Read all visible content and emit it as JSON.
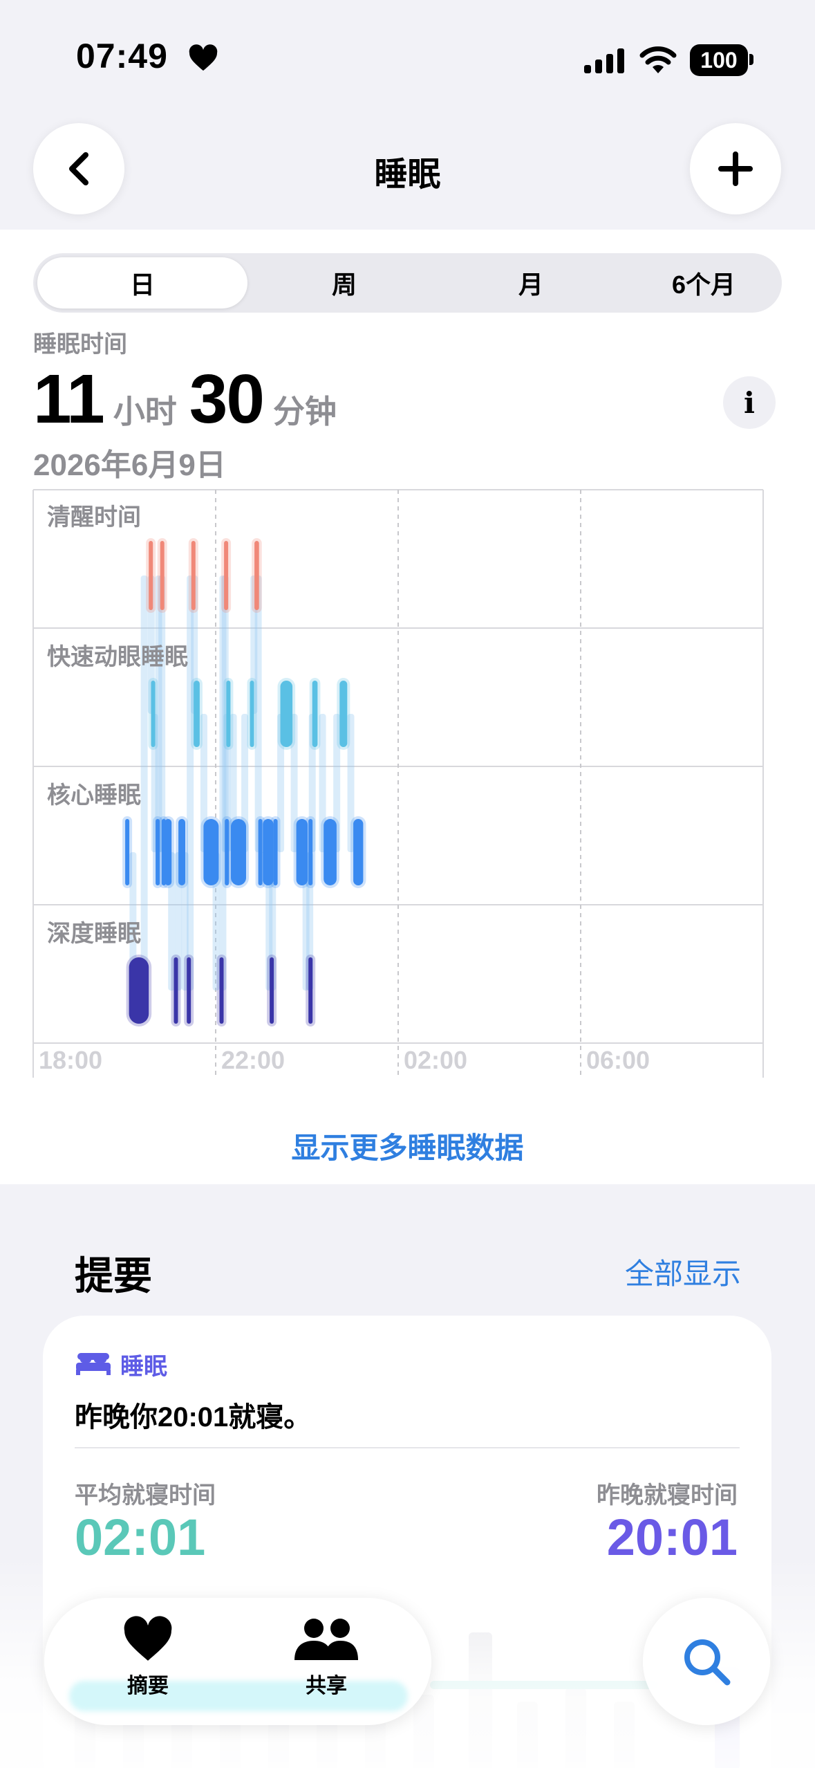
{
  "status_bar": {
    "time": "07:49",
    "battery": "100"
  },
  "nav": {
    "title": "睡眠"
  },
  "segments": [
    "日",
    "周",
    "月",
    "6个月"
  ],
  "summary": {
    "label": "睡眠时间",
    "hours": "11",
    "hours_unit": "小时",
    "minutes": "30",
    "minutes_unit": "分钟",
    "date": "2026年6月9日"
  },
  "stages": [
    "清醒时间",
    "快速动眼睡眠",
    "核心睡眠",
    "深度睡眠"
  ],
  "chart_data": {
    "type": "timeline",
    "x_ticks": [
      "18:00",
      "22:00",
      "02:00",
      "06:00"
    ],
    "stage_order": [
      "awake",
      "rem",
      "core",
      "deep"
    ],
    "colors": {
      "awake": "#f08878",
      "rem": "#5ac0e4",
      "core": "#3a8af0",
      "deep": "#3a35a8"
    },
    "segments": [
      {
        "stage": "core",
        "start": "20:01",
        "end": "20:06"
      },
      {
        "stage": "deep",
        "start": "20:06",
        "end": "20:32"
      },
      {
        "stage": "awake",
        "start": "20:32",
        "end": "20:34"
      },
      {
        "stage": "rem",
        "start": "20:35",
        "end": "20:40"
      },
      {
        "stage": "core",
        "start": "20:41",
        "end": "20:43"
      },
      {
        "stage": "awake",
        "start": "20:47",
        "end": "20:49"
      },
      {
        "stage": "core",
        "start": "20:49",
        "end": "20:52"
      },
      {
        "stage": "core",
        "start": "20:53",
        "end": "21:02"
      },
      {
        "stage": "deep",
        "start": "21:05",
        "end": "21:08"
      },
      {
        "stage": "core",
        "start": "21:11",
        "end": "21:20"
      },
      {
        "stage": "deep",
        "start": "21:22",
        "end": "21:26"
      },
      {
        "stage": "awake",
        "start": "21:28",
        "end": "21:30"
      },
      {
        "stage": "rem",
        "start": "21:31",
        "end": "21:39"
      },
      {
        "stage": "core",
        "start": "21:44",
        "end": "22:04"
      },
      {
        "stage": "deep",
        "start": "22:05",
        "end": "22:09"
      },
      {
        "stage": "awake",
        "start": "22:11",
        "end": "22:13"
      },
      {
        "stage": "core",
        "start": "22:12",
        "end": "22:14"
      },
      {
        "stage": "rem",
        "start": "22:14",
        "end": "22:19"
      },
      {
        "stage": "core",
        "start": "22:20",
        "end": "22:40"
      },
      {
        "stage": "rem",
        "start": "22:45",
        "end": "22:48"
      },
      {
        "stage": "awake",
        "start": "22:51",
        "end": "22:57"
      },
      {
        "stage": "core",
        "start": "22:56",
        "end": "23:00"
      },
      {
        "stage": "core",
        "start": "23:02",
        "end": "23:16"
      },
      {
        "stage": "deep",
        "start": "23:11",
        "end": "23:12"
      },
      {
        "stage": "core",
        "start": "23:16",
        "end": "23:20"
      },
      {
        "stage": "rem",
        "start": "23:25",
        "end": "23:41"
      },
      {
        "stage": "core",
        "start": "23:46",
        "end": "24:01"
      },
      {
        "stage": "deep",
        "start": "24:02",
        "end": "24:06"
      },
      {
        "stage": "core",
        "start": "24:02",
        "end": "24:05"
      },
      {
        "stage": "rem",
        "start": "24:07",
        "end": "24:14"
      },
      {
        "stage": "core",
        "start": "24:22",
        "end": "24:39"
      },
      {
        "stage": "rem",
        "start": "24:43",
        "end": "24:53"
      },
      {
        "stage": "core",
        "start": "25:01",
        "end": "25:14"
      }
    ]
  },
  "more_link": "显示更多睡眠数据",
  "highlights": {
    "title": "提要",
    "show_all": "全部显示",
    "card": {
      "category": "睡眠",
      "text": "昨晚你20:01就寝。",
      "avg_label": "平均就寝时间",
      "avg_value": "02:01",
      "last_label": "昨晚就寝时间",
      "last_value": "20:01"
    }
  },
  "tabs": {
    "summary": "摘要",
    "sharing": "共享"
  }
}
